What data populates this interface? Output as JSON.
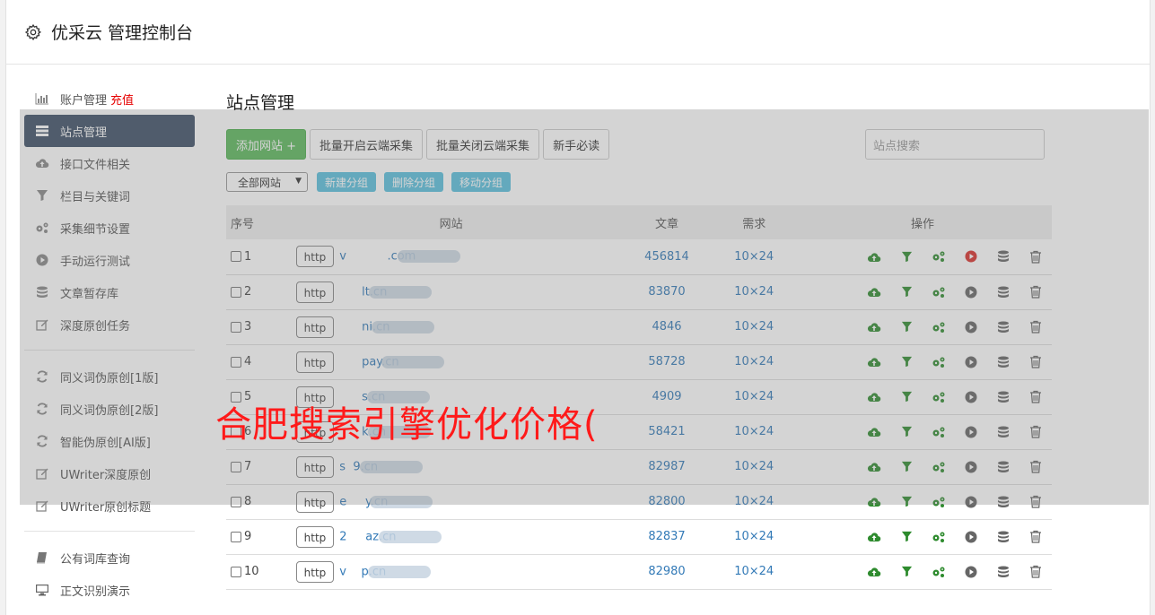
{
  "app": {
    "title": "优采云 管理控制台",
    "icon": "gear-icon"
  },
  "sidebar": {
    "groups": [
      [
        {
          "label": "账户管理",
          "extra": "充值",
          "icon": "bar-chart-icon"
        },
        {
          "label": "站点管理",
          "icon": "server-list-icon",
          "active": true
        },
        {
          "label": "接口文件相关",
          "icon": "cloud-upload-icon"
        },
        {
          "label": "栏目与关键词",
          "icon": "filter-icon"
        },
        {
          "label": "采集细节设置",
          "icon": "gears-icon"
        },
        {
          "label": "手动运行测试",
          "icon": "play-circle-icon"
        },
        {
          "label": "文章暂存库",
          "icon": "database-icon"
        },
        {
          "label": "深度原创任务",
          "icon": "edit-icon"
        }
      ],
      [
        {
          "label": "同义词伪原创[1版]",
          "icon": "refresh-icon"
        },
        {
          "label": "同义词伪原创[2版]",
          "icon": "refresh-icon"
        },
        {
          "label": "智能伪原创[AI版]",
          "icon": "refresh-icon"
        },
        {
          "label": "UWriter深度原创",
          "icon": "edit-icon"
        },
        {
          "label": "UWriter原创标题",
          "icon": "edit-icon"
        }
      ],
      [
        {
          "label": "公有词库查询",
          "icon": "book-icon"
        },
        {
          "label": "正文识别演示",
          "icon": "monitor-icon"
        }
      ]
    ],
    "extra_color": "#e60000"
  },
  "main": {
    "title": "站点管理",
    "toolbar": {
      "add_site": "添加网站 +",
      "batch_open": "批量开启云端采集",
      "batch_close": "批量关闭云端采集",
      "newbie": "新手必读",
      "search_placeholder": "站点搜索"
    },
    "group_bar": {
      "select_value": "全部网站",
      "new_group": "新建分组",
      "delete_group": "删除分组",
      "move_group": "移动分组"
    },
    "table": {
      "headers": {
        "idx": "序号",
        "site": "网站",
        "articles": "文章",
        "demand": "需求",
        "ops": "操作"
      },
      "rows": [
        {
          "idx": "1",
          "proto": "http",
          "domain": "v           .com",
          "articles": "456814",
          "demand": "10×24",
          "play_color": "#d9302b"
        },
        {
          "idx": "2",
          "proto": "http",
          "domain": "      lt.cn",
          "articles": "83870",
          "demand": "10×24",
          "play_color": "#666666"
        },
        {
          "idx": "3",
          "proto": "http",
          "domain": "      ni.cn",
          "articles": "4846",
          "demand": "10×24",
          "play_color": "#666666"
        },
        {
          "idx": "4",
          "proto": "http",
          "domain": "      pay.cn",
          "articles": "58728",
          "demand": "10×24",
          "play_color": "#666666"
        },
        {
          "idx": "5",
          "proto": "http",
          "domain": "      s.cn",
          "articles": "4909",
          "demand": "10×24",
          "play_color": "#666666"
        },
        {
          "idx": "6",
          "proto": "http",
          "domain": "      k.cn",
          "articles": "58421",
          "demand": "10×24",
          "play_color": "#666666"
        },
        {
          "idx": "7",
          "proto": "http",
          "domain": "s  9.cn",
          "articles": "82987",
          "demand": "10×24",
          "play_color": "#666666"
        },
        {
          "idx": "8",
          "proto": "http",
          "domain": "e     y.cn",
          "articles": "82800",
          "demand": "10×24",
          "play_color": "#666666"
        },
        {
          "idx": "9",
          "proto": "http",
          "domain": "2     az.cn",
          "articles": "82837",
          "demand": "10×24",
          "play_color": "#666666"
        },
        {
          "idx": "10",
          "proto": "http",
          "domain": "v    p.cn",
          "articles": "82980",
          "demand": "10×24",
          "play_color": "#666666"
        }
      ]
    }
  },
  "overlay_text": "合肥搜索引擎优化价格(",
  "colors": {
    "accent_green": "#5cb85c",
    "info_blue": "#5bc0de",
    "link_blue": "#337ab7",
    "op_green": "#2e8b2e",
    "active_nav": "#3d4e66"
  }
}
